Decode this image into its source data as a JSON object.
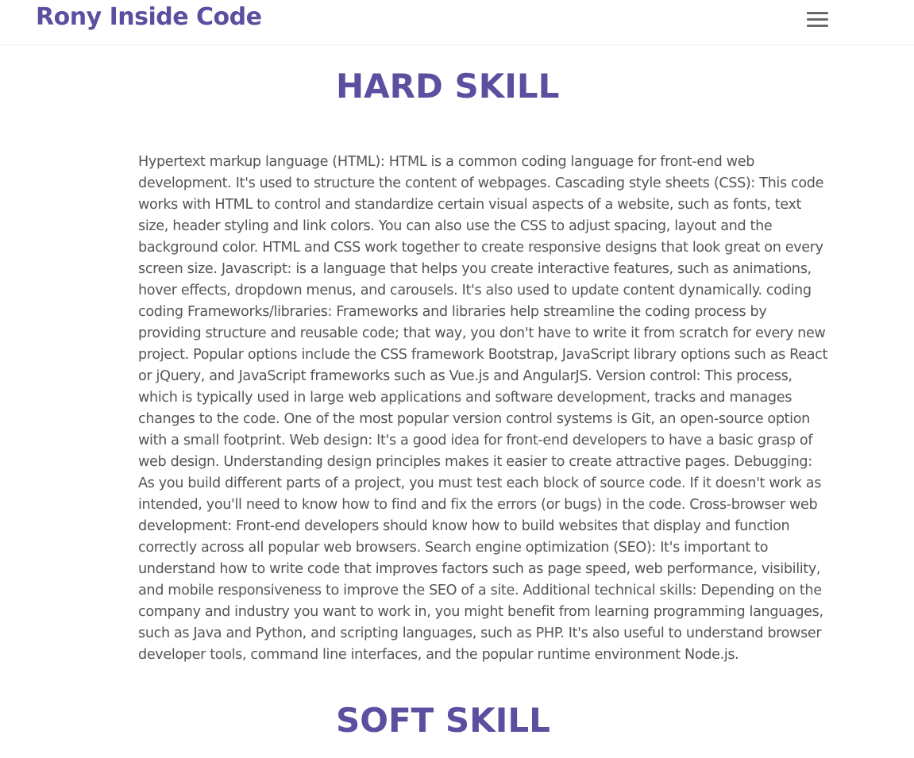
{
  "navbar": {
    "brand": "Rony Inside Code",
    "menu_icon": "hamburger-menu-icon"
  },
  "hard_skill": {
    "title": "HARD SKILL",
    "body": "Hypertext markup language (HTML): HTML is a common coding language for front-end web development. It's used to structure the content of webpages. Cascading style sheets (CSS): This code works with HTML to control and standardize certain visual aspects of a website, such as fonts, text size, header styling and link colors. You can also use the CSS to adjust spacing, layout and the background color. HTML and CSS work together to create responsive designs that look great on every screen size. Javascript: is a language that helps you create interactive features, such as animations, hover effects, dropdown menus, and carousels. It's also used to update content dynamically. coding coding Frameworks/libraries: Frameworks and libraries help streamline the coding process by providing structure and reusable code; that way, you don't have to write it from scratch for every new project. Popular options include the CSS framework Bootstrap, JavaScript library options such as React or jQuery, and JavaScript frameworks such as Vue.js and AngularJS. Version control: This process, which is typically used in large web applications and software development, tracks and manages changes to the code. One of the most popular version control systems is Git, an open-source option with a small footprint. Web design: It's a good idea for front-end developers to have a basic grasp of web design. Understanding design principles makes it easier to create attractive pages. Debugging: As you build different parts of a project, you must test each block of source code. If it doesn't work as intended, you'll need to know how to find and fix the errors (or bugs) in the code. Cross-browser web development: Front-end developers should know how to build websites that display and function correctly across all popular web browsers. Search engine optimization (SEO): It's important to understand how to write code that improves factors such as page speed, web performance, visibility, and mobile responsiveness to improve the SEO of a site. Additional technical skills: Depending on the company and industry you want to work in, you might benefit from learning programming languages, such as Java and Python, and scripting languages, such as PHP. It's also useful to understand browser developer tools, command line interfaces, and the popular runtime environment Node.js."
  },
  "soft_skill": {
    "title": "SOFT SKILL"
  },
  "colors": {
    "accent": "#5b4fa0",
    "body_text": "#555555",
    "menu_icon": "#6a6a6a",
    "background": "#ffffff"
  }
}
